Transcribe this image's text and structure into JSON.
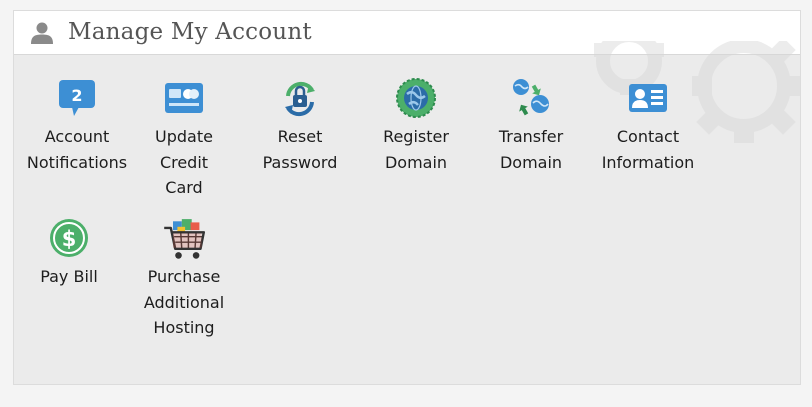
{
  "header": {
    "title": "Manage My Account",
    "icon": "user-icon"
  },
  "notifications": {
    "count": "2"
  },
  "tiles": [
    {
      "label": "Account\nNotifications",
      "icon": "chat-badge-icon"
    },
    {
      "label": "Update\nCredit\nCard",
      "icon": "credit-card-icon"
    },
    {
      "label": "Reset\nPassword",
      "icon": "lock-refresh-icon"
    },
    {
      "label": "Register\nDomain",
      "icon": "globe-badge-icon"
    },
    {
      "label": "Transfer\nDomain",
      "icon": "globe-transfer-icon"
    },
    {
      "label": "Contact\nInformation",
      "icon": "id-card-icon"
    },
    {
      "label": "Pay Bill",
      "icon": "dollar-circle-icon"
    },
    {
      "label": "Purchase\nAdditional\nHosting",
      "icon": "shopping-cart-icon"
    }
  ],
  "colors": {
    "accent_blue": "#3d8fd4",
    "accent_green": "#4caf6a",
    "header_text": "#555555",
    "panel_bg": "#ebebeb"
  }
}
